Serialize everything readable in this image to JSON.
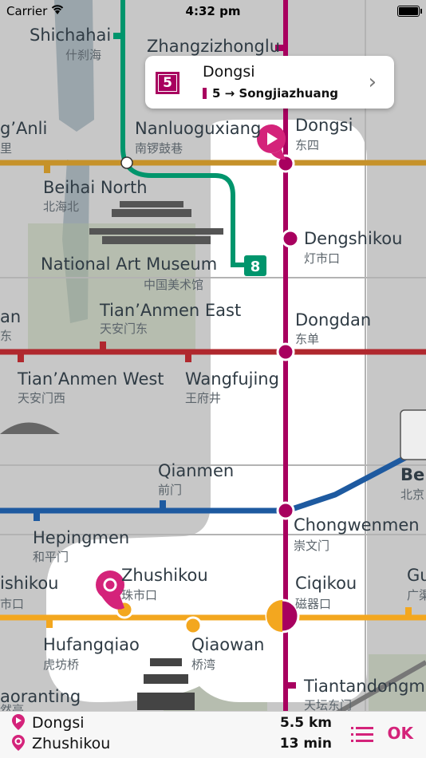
{
  "status": {
    "carrier": "Carrier",
    "time": "4:32 pm"
  },
  "colors": {
    "line5": "#a8005f",
    "line8": "#00956c",
    "line2": "#3b73b9",
    "line7": "#f3a71f",
    "line6": "#c6922a",
    "line1": "#b0282e"
  },
  "callout": {
    "line_number": "5",
    "title": "Dongsi",
    "direction": "5 → Songjiazhuang",
    "chevron": "›"
  },
  "map_labels": {
    "shichahai_en": "Shichahai",
    "shichahai_cn": "什刹海",
    "zhangzizhonglu_en": "Zhangzizhonglu",
    "anli_en": "g’Anli",
    "anli_cn": "里",
    "nanluoguxiang_en": "Nanluoguxiang",
    "nanluoguxiang_cn": "南锣鼓巷",
    "dongsi_en": "Dongsi",
    "dongsi_cn": "东四",
    "beihai_en": "Beihai North",
    "beihai_cn": "北海北",
    "dengshikou_en": "Dengshikou",
    "dengshikou_cn": "灯市口",
    "museum_en": "National Art Museum",
    "museum_cn": "中国美术馆",
    "line8_badge": "8",
    "an_en": "an",
    "an_cn": "东",
    "tiananmen_east_en": "Tian’Anmen East",
    "tiananmen_east_cn": "天安门东",
    "dongdan_en": "Dongdan",
    "dongdan_cn": "东单",
    "tiananmen_west_en": "Tian’Anmen West",
    "tiananmen_west_cn": "天安门西",
    "wangfujing_en": "Wangfujing",
    "wangfujing_cn": "王府井",
    "qianmen_en": "Qianmen",
    "qianmen_cn": "前门",
    "bei_en": "Bei",
    "bei_cn": "北京",
    "hepingmen_en": "Hepingmen",
    "hepingmen_cn": "和平门",
    "chongwenmen_en": "Chongwenmen",
    "chongwenmen_cn": "崇文门",
    "ishikou_en": "ishikou",
    "ishikou_cn": "市口",
    "zhushikou_en": "Zhushikou",
    "zhushikou_cn": "珠市口",
    "ciqikou_en": "Ciqikou",
    "ciqikou_cn": "磁器口",
    "gu_en": "Gu",
    "gu_cn": "广渠",
    "hufangqiao_en": "Hufangqiao",
    "hufangqiao_cn": "虎坊桥",
    "qiaowan_en": "Qiaowan",
    "qiaowan_cn": "桥湾",
    "taoranting_en": "aoranting",
    "taoranting_cn": "然亭",
    "tiantandongmen_en": "Tiantandongme",
    "tiantandongmen_cn": "天坛东门"
  },
  "route": {
    "from": "Dongsi",
    "to": "Zhushikou",
    "distance": "5.5 km",
    "duration": "13 min",
    "ok_label": "OK"
  }
}
